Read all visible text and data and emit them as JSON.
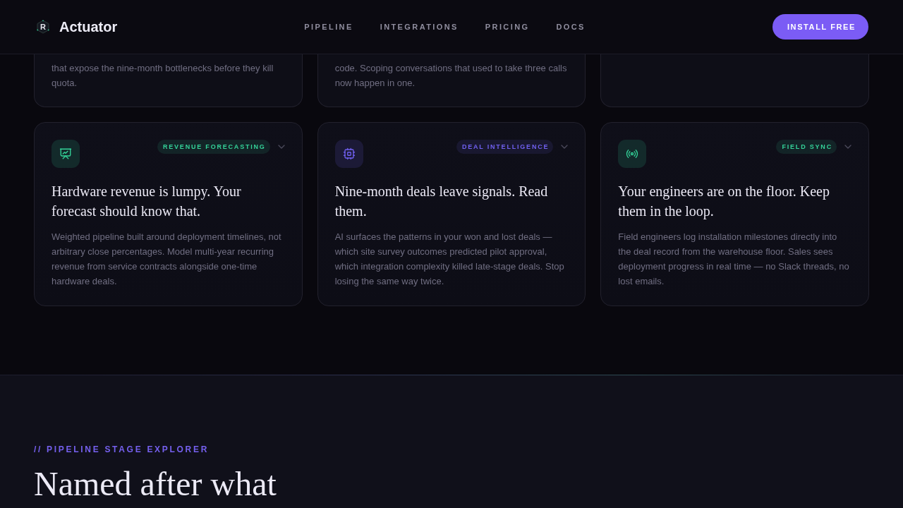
{
  "header": {
    "logo_mark": "R",
    "brand": "Actuator",
    "nav": [
      "PIPELINE",
      "INTEGRATIONS",
      "PRICING",
      "DOCS"
    ],
    "cta": "INSTALL FREE"
  },
  "cards_top": [
    {
      "kind": "text",
      "description": "that expose the nine-month bottlenecks before they kill quota."
    },
    {
      "kind": "text",
      "description": "code. Scoping conversations that used to take three calls now happen in one."
    },
    {
      "kind": "blank"
    }
  ],
  "cards": [
    {
      "kind": "chart",
      "tag": "REVENUE FORECASTING",
      "color": "#34d399",
      "expanded": false,
      "title": "Hardware revenue is lumpy. Your forecast should know that.",
      "description": "Weighted pipeline built around deployment timelines, not arbitrary close percentages. Model multi-year recurring revenue from service contracts alongside one-time hardware deals."
    },
    {
      "kind": "chip",
      "tag": "DEAL INTELLIGENCE",
      "color": "#7060f0",
      "expanded": false,
      "title": "Nine-month deals leave signals. Read them.",
      "description": "AI surfaces the patterns in your won and lost deals — which site survey outcomes predicted pilot approval, which integration complexity killed late-stage deals. Stop losing the same way twice."
    },
    {
      "kind": "signal",
      "tag": "FIELD SYNC",
      "color": "#34d399",
      "expanded": false,
      "title": "Your engineers are on the floor. Keep them in the loop.",
      "description": "Field engineers log installation milestones directly into the deal record from the warehouse floor. Sales sees deployment progress in real time — no Slack threads, no lost emails."
    }
  ],
  "explorer": {
    "eyebrow": "// PIPELINE STAGE EXPLORER",
    "heading": "Named after what"
  }
}
